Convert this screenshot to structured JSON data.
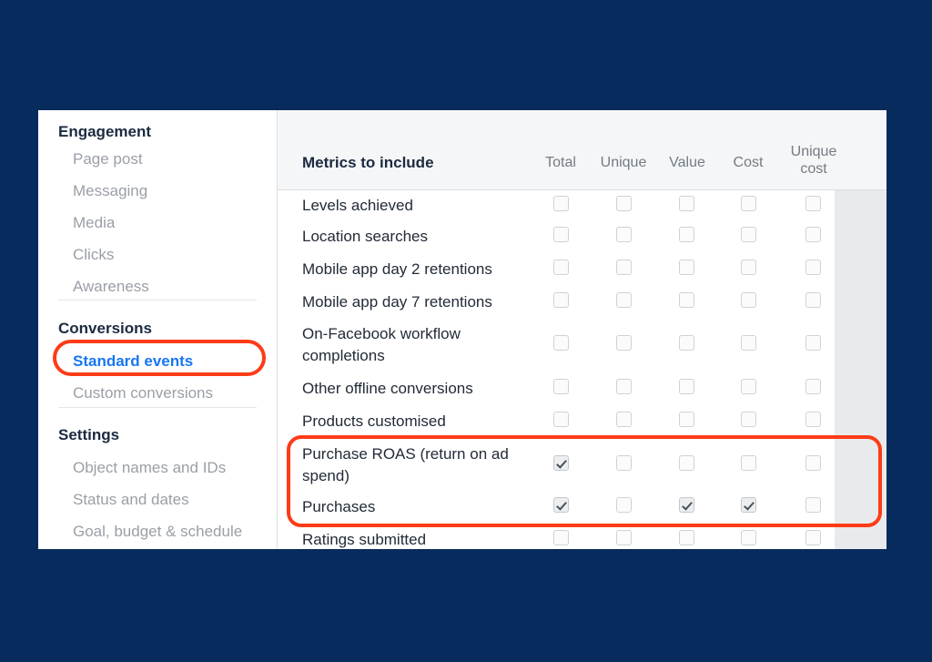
{
  "theme": {
    "background": "#072b5c",
    "panel_bg": "#ffffff",
    "header_bg": "#f5f6f7",
    "accent_link": "#1877f2",
    "annotation": "#fc3c17",
    "muted_text": "#9a9fa6",
    "heading_text": "#1c2b41"
  },
  "sidebar": {
    "groups": [
      {
        "heading": "Engagement",
        "items": [
          {
            "label": "Page post",
            "selected": false
          },
          {
            "label": "Messaging",
            "selected": false
          },
          {
            "label": "Media",
            "selected": false
          },
          {
            "label": "Clicks",
            "selected": false
          },
          {
            "label": "Awareness",
            "selected": false
          }
        ]
      },
      {
        "heading": "Conversions",
        "items": [
          {
            "label": "Standard events",
            "selected": true
          },
          {
            "label": "Custom conversions",
            "selected": false
          }
        ]
      },
      {
        "heading": "Settings",
        "items": [
          {
            "label": "Object names and IDs",
            "selected": false
          },
          {
            "label": "Status and dates",
            "selected": false
          },
          {
            "label": "Goal, budget & schedule",
            "selected": false
          }
        ]
      }
    ]
  },
  "table": {
    "title": "Metrics to include",
    "columns": [
      "Total",
      "Unique",
      "Value",
      "Cost",
      "Unique cost"
    ],
    "rows": [
      {
        "label": "Levels achieved",
        "checks": [
          false,
          false,
          false,
          false,
          false
        ]
      },
      {
        "label": "Location searches",
        "checks": [
          false,
          false,
          false,
          false,
          false
        ]
      },
      {
        "label": "Mobile app day 2 retentions",
        "checks": [
          false,
          false,
          false,
          false,
          false
        ]
      },
      {
        "label": "Mobile app day 7 retentions",
        "checks": [
          false,
          false,
          false,
          false,
          false
        ]
      },
      {
        "label": "On-Facebook workflow completions",
        "checks": [
          false,
          false,
          false,
          false,
          false
        ]
      },
      {
        "label": "Other offline conversions",
        "checks": [
          false,
          false,
          false,
          false,
          false
        ]
      },
      {
        "label": "Products customised",
        "checks": [
          false,
          false,
          false,
          false,
          false
        ]
      },
      {
        "label": "Purchase ROAS (return on ad spend)",
        "checks": [
          true,
          false,
          false,
          false,
          false
        ]
      },
      {
        "label": "Purchases",
        "checks": [
          true,
          false,
          true,
          true,
          false
        ]
      },
      {
        "label": "Ratings submitted",
        "checks": [
          false,
          false,
          false,
          false,
          false
        ]
      }
    ]
  },
  "annotations": [
    {
      "name": "standard-events-highlight",
      "shape": "rounded-oval",
      "color": "#fc3c17"
    },
    {
      "name": "purchase-rows-highlight",
      "shape": "rounded-rect",
      "color": "#fc3c17"
    }
  ],
  "scrollbar": {
    "orientation": "vertical",
    "position_pct": 83
  }
}
